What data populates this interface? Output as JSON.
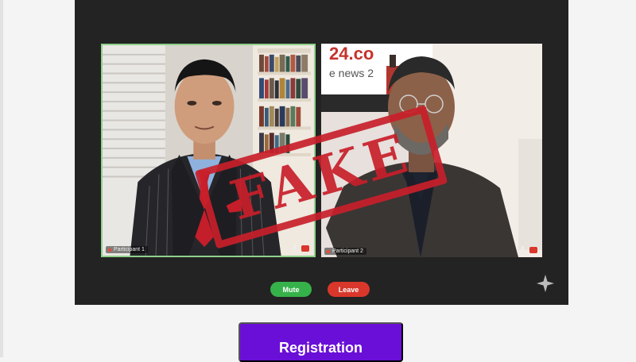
{
  "call": {
    "participants": [
      {
        "label": "Participant 1"
      },
      {
        "label": "Participant 2"
      }
    ],
    "backdrop_text": {
      "line1": "24.co",
      "line2": "e news 2"
    },
    "mute_label": "Mute",
    "leave_label": "Leave",
    "icons": [
      "mic-icon",
      "camera-off-icon",
      "sparkle-icon"
    ]
  },
  "stamp": {
    "text": "FAKE"
  },
  "registration": {
    "label": "Registration"
  },
  "colors": {
    "call_background": "#232323",
    "active_speaker_border": "#8fd18b",
    "mute_green": "#36b24a",
    "leave_red": "#d9372b",
    "stamp_red": "#c81f2a",
    "registration_purple": "#6a0fd8"
  }
}
